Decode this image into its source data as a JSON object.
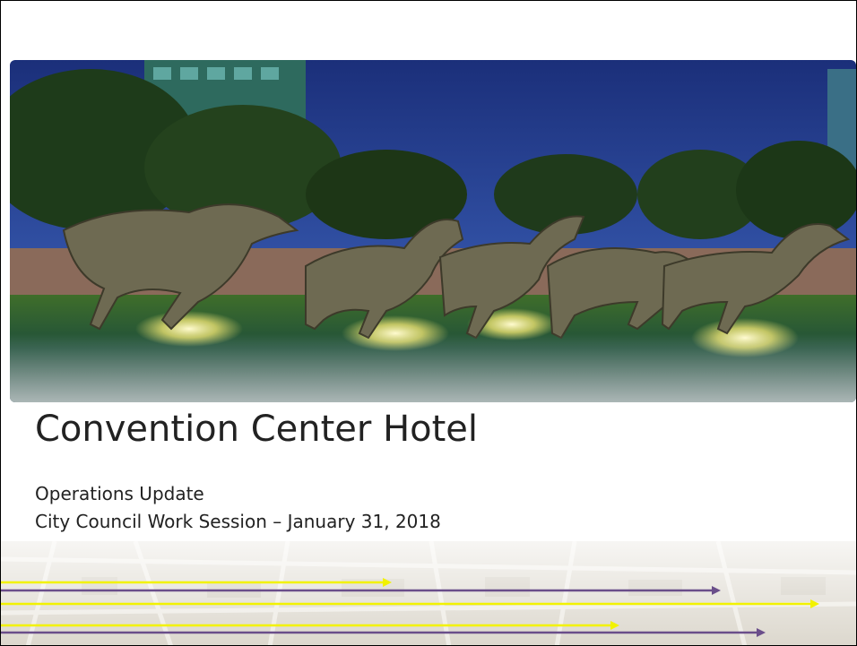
{
  "slide": {
    "title": "Convention Center Hotel",
    "subtitle_line1": "Operations Update",
    "subtitle_line2": "City Council Work Session – January 31, 2018",
    "hero_image": "mustangs-sculpture-fountain-night-photo",
    "footer_image": "faded-street-map-background"
  },
  "colors": {
    "text": "#222222",
    "arrow_yellow": "#f2f200",
    "arrow_purple": "#6a4e8a",
    "sky": "#1f3d8c",
    "water": "#1f5a3a"
  }
}
